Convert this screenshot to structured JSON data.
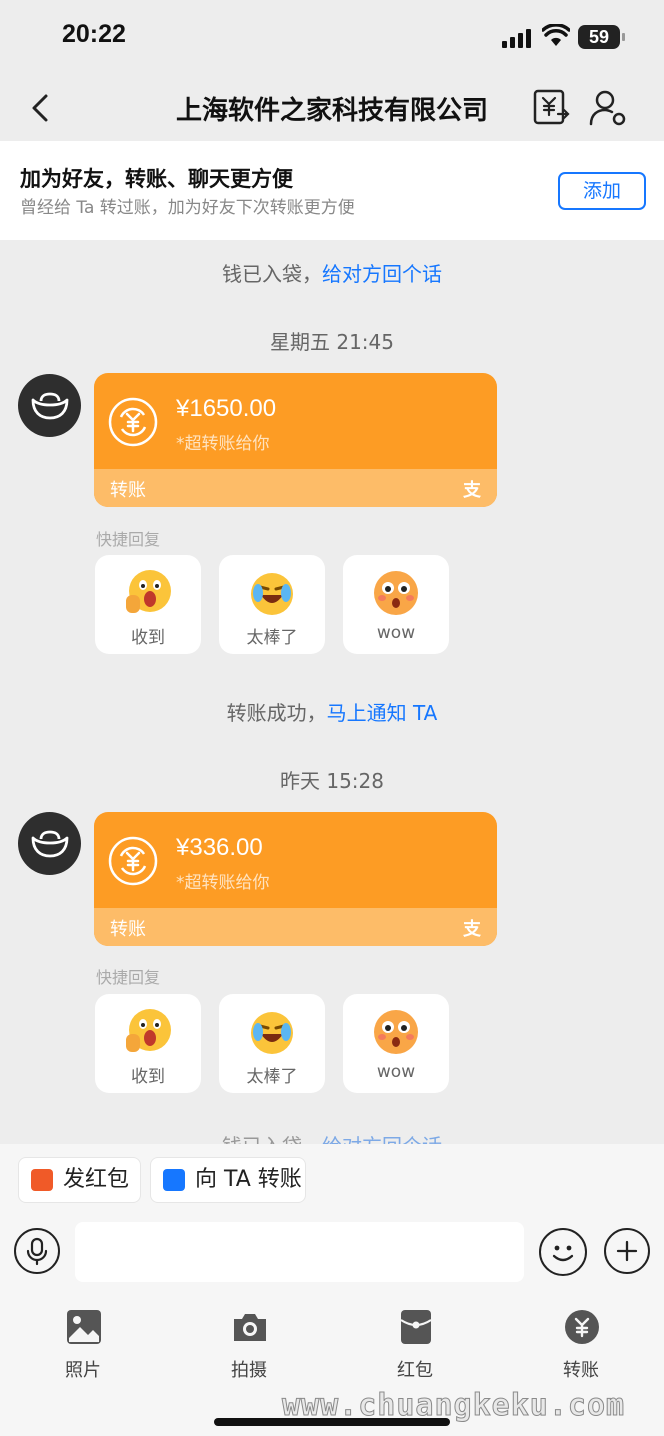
{
  "status_bar": {
    "time": "20:22",
    "battery": "59"
  },
  "header": {
    "title": "上海软件之家科技有限公司"
  },
  "banner": {
    "title": "加为好友，转账、聊天更方便",
    "subtitle": "曾经给 Ta 转过账，加为好友下次转账更方便",
    "add_label": "添加"
  },
  "chat": {
    "sys1": {
      "text": "钱已入袋，",
      "link": "给对方回个话"
    },
    "time1": "星期五 21:45",
    "card1": {
      "amount": "¥1650.00",
      "note": "*超转账给你",
      "footer": "转账",
      "logo": "支"
    },
    "quick_label1": "快捷回复",
    "quick1": [
      "收到",
      "太棒了",
      "wow"
    ],
    "sys2": {
      "text": "转账成功，",
      "link": "马上通知 TA"
    },
    "time2": "昨天 15:28",
    "card2": {
      "amount": "¥336.00",
      "note": "*超转账给你",
      "footer": "转账",
      "logo": "支"
    },
    "quick_label2": "快捷回复",
    "quick2": [
      "收到",
      "太棒了",
      "wow"
    ],
    "sys3": {
      "text": "钱已入袋，",
      "link": "给对方回个话"
    }
  },
  "bottom": {
    "shortcut1": "发红包",
    "shortcut2": "向 TA 转账",
    "input_value": "",
    "tools": [
      "照片",
      "拍摄",
      "红包",
      "转账"
    ],
    "watermark": "www.chuangkeku.com"
  },
  "colors": {
    "accent": "#1677ff",
    "card_orange": "#fd9c24",
    "card_footer": "#fdbc68",
    "background": "#ededed"
  },
  "icons": [
    "back-arrow-icon",
    "transfer-yuan-icon",
    "contact-settings-icon",
    "gold-ingot-icon",
    "yuan-coin-icon",
    "alipay-icon",
    "microphone-icon",
    "smile-icon",
    "plus-icon",
    "photo-icon",
    "camera-icon",
    "red-packet-icon",
    "transfer-icon"
  ]
}
